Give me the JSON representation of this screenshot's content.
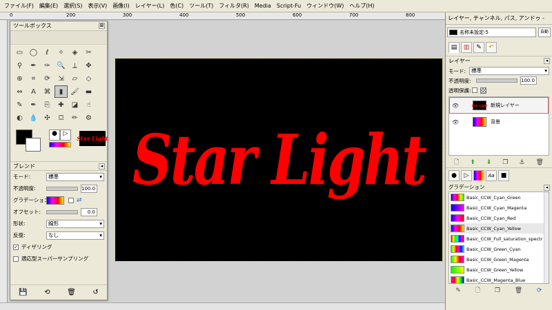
{
  "menubar": {
    "items": [
      "ファイル(F)",
      "編集(E)",
      "選択(S)",
      "表示(V)",
      "画像(I)",
      "レイヤー(L)",
      "色(C)",
      "ツール(T)",
      "フィルタ(R)",
      "Media",
      "Script-Fu",
      "ウィンドウ(W)",
      "ヘルプ(H)"
    ]
  },
  "ruler": {
    "top_labels": [
      "0",
      "200",
      "300",
      "400",
      "500",
      "600",
      "700",
      "800"
    ]
  },
  "canvas": {
    "text": "Star Light",
    "bg_color": "#000000",
    "text_color": "#ff0000"
  },
  "toolbox": {
    "title": "ツールボックス",
    "close": "⊠",
    "tools": [
      "rect-select",
      "ellipse-select",
      "free-select",
      "fuzzy-select",
      "color-select",
      "scissors",
      "foreground-select",
      "paths",
      "color-picker",
      "zoom",
      "measure",
      "move",
      "alignment",
      "crop",
      "rotate",
      "scale",
      "shear",
      "perspective",
      "flip",
      "text",
      "cage",
      "blend",
      "paintbrush",
      "eraser",
      "airbrush",
      "ink",
      "clone",
      "heal",
      "perspective-clone",
      "smudge",
      "dodge-burn",
      "convolve",
      "dodge",
      "bucket",
      "pencil",
      "gear"
    ],
    "thumb_text": "Star Light",
    "options_title": "ブレンド",
    "mode_label": "モード:",
    "mode_value": "標準",
    "opacity_label": "不透明度:",
    "opacity_value": "100.0",
    "gradient_label": "グラデーション:",
    "offset_label": "オフセット:",
    "offset_value": "0.0",
    "shape_label": "形状:",
    "shape_value": "線形",
    "repeat_label": "反復:",
    "repeat_value": "なし",
    "dither_label": "ディザリング",
    "dither_checked": true,
    "supersample_label": "適応型スーパーサンプリング",
    "supersample_checked": false
  },
  "dock": {
    "title": "レイヤー, チャンネル, パス, アンドゥ -",
    "image_name": "名称未設定-5",
    "auto_label": "自動",
    "layers_title": "レイヤー",
    "mode_label": "モード:",
    "mode_value": "標準",
    "opacity_label": "不透明度:",
    "opacity_value": "100.0",
    "lock_label": "透明保護:",
    "layers": [
      {
        "name": "新規レイヤー",
        "thumb": "Star Light",
        "selected": true
      },
      {
        "name": "背景",
        "thumb": "",
        "selected": false
      }
    ],
    "gradients_title": "グラデーション",
    "gradients": [
      {
        "name": "Basic_CCW_Cyan_Green",
        "colors": [
          "#0000ff",
          "#ff00ff",
          "#ff0000",
          "#ffff00",
          "#00ff00"
        ]
      },
      {
        "name": "Basic_CCW_Cyan_Magenta",
        "colors": [
          "#0000ff",
          "#ff00ff"
        ]
      },
      {
        "name": "Basic_CCW_Cyan_Red",
        "colors": [
          "#0000ff",
          "#ff00ff",
          "#ff0000"
        ]
      },
      {
        "name": "Basic_CCW_Cyan_Yellow",
        "colors": [
          "#0000ff",
          "#ff00ff",
          "#ff0000",
          "#ffff00"
        ]
      },
      {
        "name": "Basic_CCW_Full_saturation_spectr",
        "colors": [
          "#ff0000",
          "#ffff00",
          "#00ff00",
          "#00ffff",
          "#0000ff",
          "#ff00ff",
          "#ff0000"
        ]
      },
      {
        "name": "Basic_CCW_Green_Cyan",
        "colors": [
          "#00ff00",
          "#ffff00",
          "#ff0000",
          "#ff00ff",
          "#0000ff",
          "#00ffff"
        ]
      },
      {
        "name": "Basic_CCW_Green_Magenta",
        "colors": [
          "#00ff00",
          "#ffff00",
          "#ff0000",
          "#ff00ff"
        ]
      },
      {
        "name": "Basic_CCW_Green_Yellow",
        "colors": [
          "#00ff00",
          "#ffff00"
        ]
      },
      {
        "name": "Basic_CCW_Magenta_Blue",
        "colors": [
          "#ff00ff",
          "#ff0000",
          "#ffff00",
          "#00ff00",
          "#0000ff"
        ]
      }
    ],
    "selected_gradient_index": 3
  }
}
